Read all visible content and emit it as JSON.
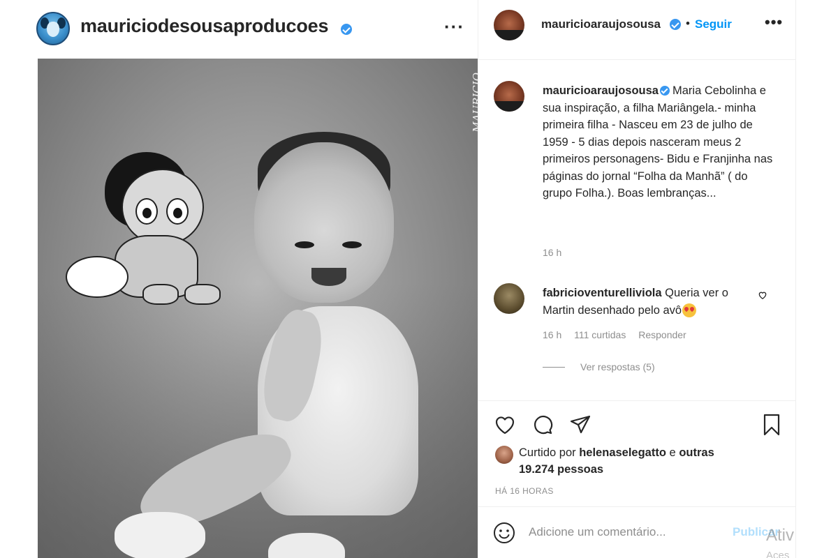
{
  "post_owner": {
    "username": "mauriciodesousaproducoes",
    "verified": true
  },
  "photo": {
    "signature": "MAURICIO",
    "alt": "Maria Cebolinha e Mariângela"
  },
  "panel_header": {
    "username": "mauricioaraujosousa",
    "separator": "•",
    "follow_label": "Seguir",
    "more_label": "•••"
  },
  "caption": {
    "username": "mauricioaraujosousa",
    "text": "Maria Cebolinha e sua inspiração, a filha Mariângela.- minha primeira filha - Nasceu em 23 de julho de 1959 - 5 dias depois nasceram meus 2 primeiros personagens- Bidu e Franjinha nas páginas do jornal “Folha da Manhã” ( do grupo Folha.). Boas lembranças...",
    "time": "16 h"
  },
  "comment": {
    "username": "fabricioventurelliviola",
    "text": "Queria ver o Martin desenhado pelo avô",
    "time": "16 h",
    "likes": "111 curtidas",
    "reply_label": "Responder",
    "view_replies": "Ver respostas (5)"
  },
  "likes": {
    "prefix": "Curtido por",
    "user": "helenaselegatto",
    "connector": "e",
    "others": "outras 19.274 pessoas"
  },
  "time_ago": "HÁ 16 HORAS",
  "comment_input": {
    "placeholder": "Adicione um comentário...",
    "publish_label": "Publicar"
  },
  "os_overlay": {
    "line1": "Ativ",
    "line2": "Aces"
  },
  "colors": {
    "link_blue": "#0095f6",
    "verified_blue": "#3897f0",
    "muted_text": "#8e8e8e",
    "publish_disabled": "#b2dffc"
  },
  "icons": [
    "heart-icon",
    "comment-icon",
    "share-icon",
    "bookmark-icon",
    "smile-icon",
    "more-icon",
    "verified-icon"
  ]
}
